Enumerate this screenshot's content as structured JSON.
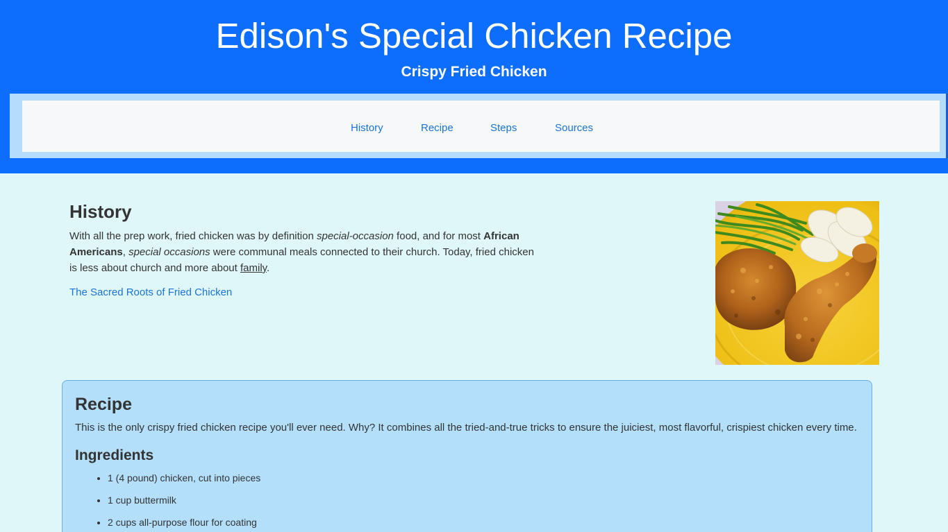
{
  "header": {
    "title": "Edison's Special Chicken Recipe",
    "subtitle": "Crispy Fried Chicken"
  },
  "nav": {
    "items": [
      "History",
      "Recipe",
      "Steps",
      "Sources"
    ]
  },
  "history": {
    "title": "History",
    "text": {
      "t1": "With all the prep work, fried chicken was by definition ",
      "i1": "special-occasion",
      "t2": " food, and for most ",
      "b1": "African Americans",
      "t3": ", ",
      "i2": "special occasions",
      "t4": " were communal meals connected to their church. Today, fried chicken is less about church and more about ",
      "u1": "family",
      "t5": "."
    },
    "link": "The Sacred Roots of Fried Chicken"
  },
  "recipe": {
    "title": "Recipe",
    "description": "This is the only crispy fried chicken recipe you'll ever need. Why? It combines all the tried-and-true tricks to ensure the juiciest, most flavorful, crispiest chicken every time.",
    "ingredients_title": "Ingredients",
    "ingredients": [
      "1 (4 pound) chicken, cut into pieces",
      "1 cup buttermilk",
      "2 cups all-purpose flour for coating"
    ]
  },
  "colors": {
    "header_bg": "#0d6efd",
    "page_bg": "#e0f7fa",
    "recipe_bg": "#b3dffb",
    "link": "#1a73d8"
  },
  "icons": {
    "photo": "fried-chicken-photo"
  }
}
